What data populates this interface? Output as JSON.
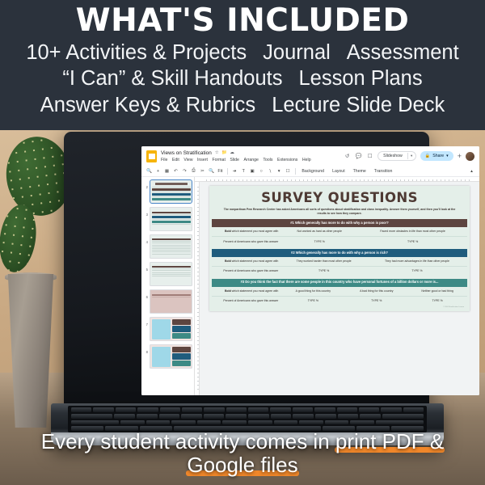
{
  "header": {
    "title": "WHAT'S INCLUDED",
    "lines": [
      [
        "10+ Activities & Projects",
        "Journal",
        "Assessment"
      ],
      [
        "“I Can” & Skill Handouts",
        "Lesson Plans"
      ],
      [
        "Answer Keys & Rubrics",
        "Lecture Slide Deck"
      ]
    ]
  },
  "app": {
    "doc_name": "Views on Stratification",
    "title_icons": [
      "star-icon",
      "move-to-folder-icon",
      "cloud-saved-icon"
    ],
    "menus": [
      "File",
      "Edit",
      "View",
      "Insert",
      "Format",
      "Slide",
      "Arrange",
      "Tools",
      "Extensions",
      "Help"
    ],
    "right_icons": [
      "version-history-icon",
      "comment-icon",
      "meet-icon"
    ],
    "slideshow_label": "Slideshow",
    "share_label": "Share",
    "toolbar_icons": [
      "search-icon",
      "add-slide-icon",
      "layout-icon",
      "undo-icon",
      "redo-icon",
      "print-icon",
      "paint-format-icon",
      "zoom-icon",
      "fit-icon",
      "select-icon",
      "text-box-icon",
      "image-icon",
      "shape-icon",
      "line-icon",
      "comment-add-icon"
    ],
    "toolbar_buttons": [
      "Background",
      "Layout",
      "Theme",
      "Transition"
    ],
    "filmstrip": [
      {
        "number": "2",
        "selected": true
      },
      {
        "number": "3",
        "selected": false
      },
      {
        "number": "4",
        "selected": false
      },
      {
        "number": "5",
        "selected": false
      },
      {
        "number": "6",
        "selected": false
      },
      {
        "number": "7",
        "selected": false
      },
      {
        "number": "8",
        "selected": false
      }
    ]
  },
  "slide": {
    "title": "SURVEY QUESTIONS",
    "intro": "The nonpartisan Pew Research Center has asked Americans all sorts of questions about stratification and class inequality. Answer them yourself, and then you'll look at the results to see how they compare.",
    "bold_label_prefix": "Bold",
    "bold_label_rest": " which statement you most agree with",
    "percent_label": "Percent of Americans who gave this answer",
    "percent_placeholder": "TYPE %",
    "credit": "© 2024 Stratification Lesson",
    "questions": [
      {
        "bar_color": "#5d4540",
        "heading": "#1 Which generally has more to do with why a person is poor?",
        "answers": [
          "Not worked as hard as other people",
          "Faced more obstacles in life than most other people"
        ]
      },
      {
        "bar_color": "#1f5c7d",
        "heading": "#2 Which generally has more to do with why a person is rich?",
        "answers": [
          "They worked harder than most other people",
          "They had more advantages in life than other people"
        ]
      },
      {
        "bar_color": "#3d8a85",
        "heading": "#3 Do you think the fact that there are some people in this country who have personal fortunes of a billion dollars or more is...",
        "answers": [
          "A good thing for this country",
          "A bad thing for this country",
          "Neither good or bad thing"
        ]
      }
    ]
  },
  "bottom": {
    "line1_plain": "Every student activity comes in ",
    "line1_highlight": "print PDF &",
    "line2_highlight": "Google files"
  },
  "colors": {
    "banner_bg": "#2b323c",
    "highlight": "#f0872a",
    "slide_bg": "#e4efe9",
    "slide_title": "#4e3a34",
    "q1": "#5d4540",
    "q2": "#1f5c7d",
    "q3": "#3d8a85",
    "type_text": "#4a51c4",
    "share_bg": "#c2e7ff"
  }
}
